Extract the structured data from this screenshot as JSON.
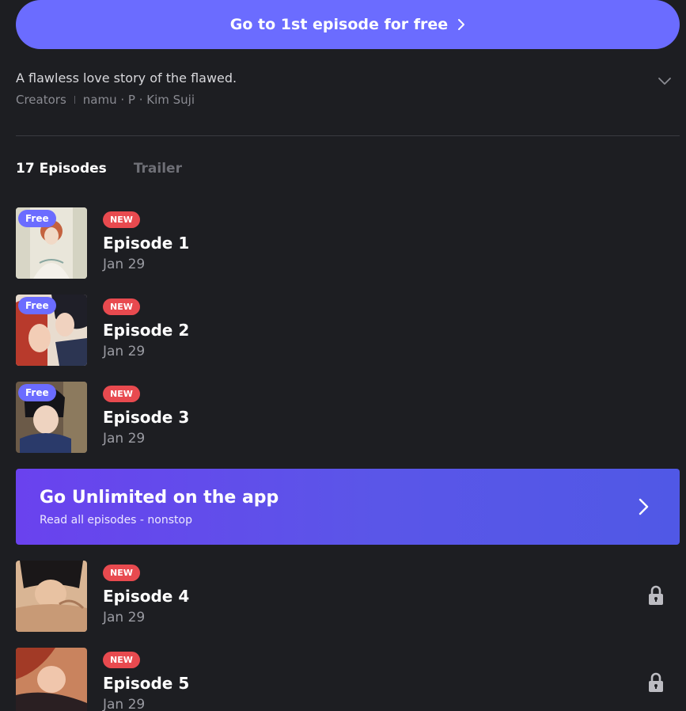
{
  "cta": {
    "label": "Go to 1st episode for free",
    "color": "#6b6cff"
  },
  "description": "A flawless love story of the flawed.",
  "creators": {
    "label": "Creators",
    "names": "namu · P · Kim Suji"
  },
  "tabs": [
    {
      "label": "17 Episodes",
      "active": true
    },
    {
      "label": "Trailer",
      "active": false
    }
  ],
  "episodes": [
    {
      "badge_free": "Free",
      "badge_new": "NEW",
      "title": "Episode 1",
      "date": "Jan 29",
      "locked": false
    },
    {
      "badge_free": "Free",
      "badge_new": "NEW",
      "title": "Episode 2",
      "date": "Jan 29",
      "locked": false
    },
    {
      "badge_free": "Free",
      "badge_new": "NEW",
      "title": "Episode 3",
      "date": "Jan 29",
      "locked": false
    },
    {
      "badge_new": "NEW",
      "title": "Episode 4",
      "date": "Jan 29",
      "locked": true
    },
    {
      "badge_new": "NEW",
      "title": "Episode 5",
      "date": "Jan 29",
      "locked": true
    }
  ],
  "unlimited": {
    "title": "Go Unlimited on the app",
    "subtitle": "Read all episodes - nonstop"
  },
  "colors": {
    "background": "#1d1e22",
    "accent": "#6b6cff",
    "new_badge": "#e84a4f"
  },
  "icons": {
    "expand": "chevron-down-icon",
    "cta_arrow": "chevron-right-icon",
    "lock": "lock-icon"
  }
}
